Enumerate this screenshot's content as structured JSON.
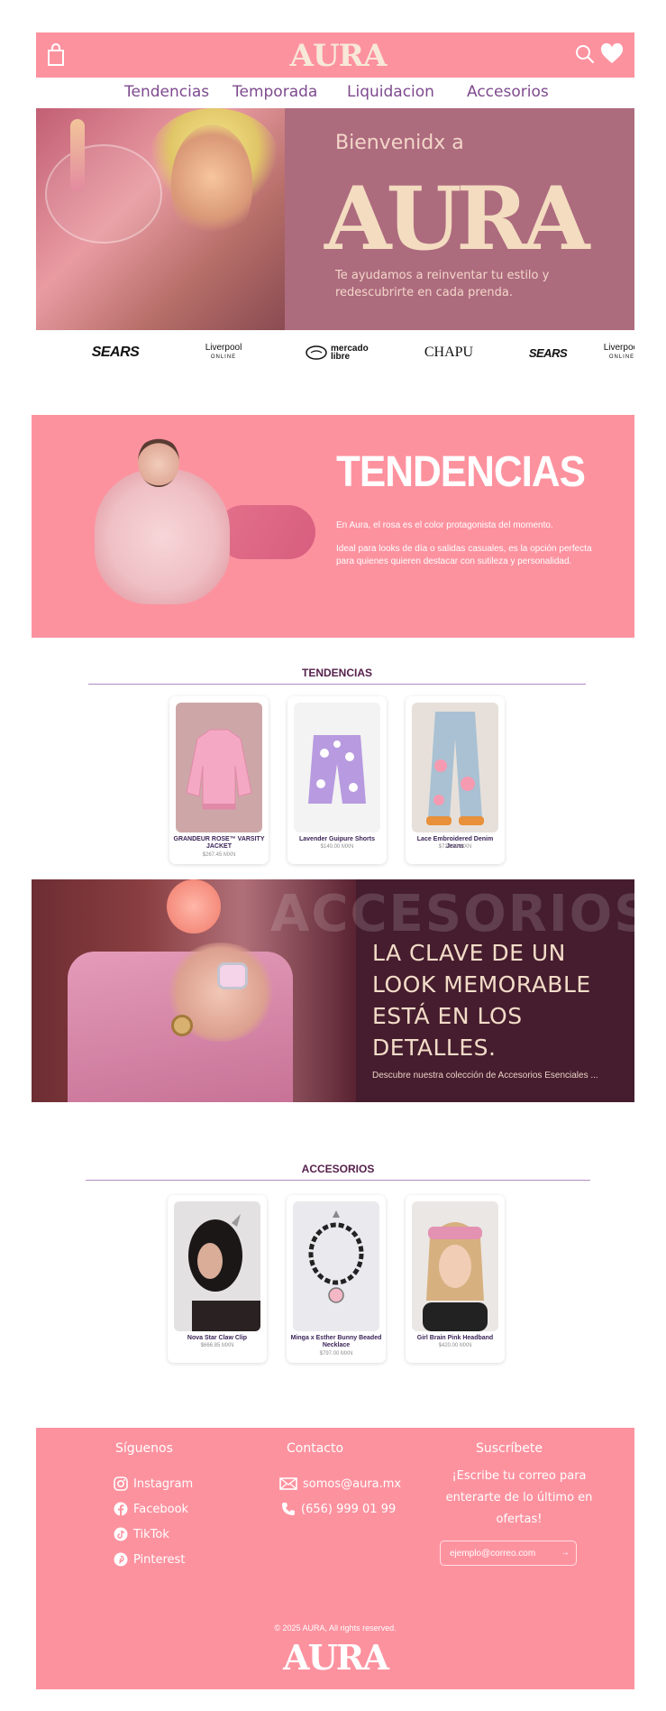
{
  "header": {
    "logo": "AURA",
    "nav": [
      "Tendencias",
      "Temporada",
      "Liquidacion",
      "Accesorios"
    ]
  },
  "hero": {
    "welcome": "Bienvenidx a",
    "logo": "AURA",
    "subtitle": "Te ayudamos a reinventar tu estilo y redescubrirte en cada prenda."
  },
  "brands": [
    "SEARS",
    "Liverpool",
    "mercado libre",
    "CHAPU",
    "SEARS",
    "Liverpool"
  ],
  "tendencias_banner": {
    "title": "TENDENCIAS",
    "p1": "En Aura, el rosa es el color protagonista del momento.",
    "p2": "Ideal para looks de día o salidas casuales, es la opción perfecta para quienes quieren destacar con sutileza y personalidad."
  },
  "tendencias_section": {
    "title": "TENDENCIAS",
    "products": [
      {
        "name": "GRANDEUR ROSE™ VARSITY JACKET",
        "price": "$267.45 MXN"
      },
      {
        "name": "Lavender Guipure Shorts",
        "price": "$140.00 MXN"
      },
      {
        "name": "Lace Embroidered Denim Jeans",
        "price": "$728.00 MXN"
      }
    ]
  },
  "accesorios_banner": {
    "bg_text": "ACCESORIOS",
    "headline": "LA CLAVE DE UN LOOK MEMORABLE ESTÁ EN LOS DETALLES.",
    "sub": "Descubre nuestra colección de Accesorios Esenciales ..."
  },
  "accesorios_section": {
    "title": "ACCESORIOS",
    "products": [
      {
        "name": "Nova Star Claw Clip",
        "price": "$666.85 MXN"
      },
      {
        "name": "Minga x Esther Bunny Beaded Necklace",
        "price": "$797.00 MXN"
      },
      {
        "name": "Girl Brain Pink Headband",
        "price": "$420.00 MXN"
      }
    ]
  },
  "footer": {
    "follow_title": "Síguenos",
    "social": [
      "Instagram",
      "Facebook",
      "TikTok",
      "Pinterest"
    ],
    "contact_title": "Contacto",
    "email": "somos@aura.mx",
    "phone": "(656) 999 01 99",
    "subscribe_title": "Suscríbete",
    "subscribe_text": "¡Escribe tu correo para enterarte de lo último en ofertas!",
    "input_placeholder": "ejemplo@correo.com",
    "copyright": "© 2025 AURA, All rights reserved.",
    "logo": "AURA"
  },
  "colors": {
    "pink": "#fd929f",
    "mauve": "#ad6b7e",
    "purple_text": "#7e4a8e",
    "dark_plum": "#451d2e"
  }
}
